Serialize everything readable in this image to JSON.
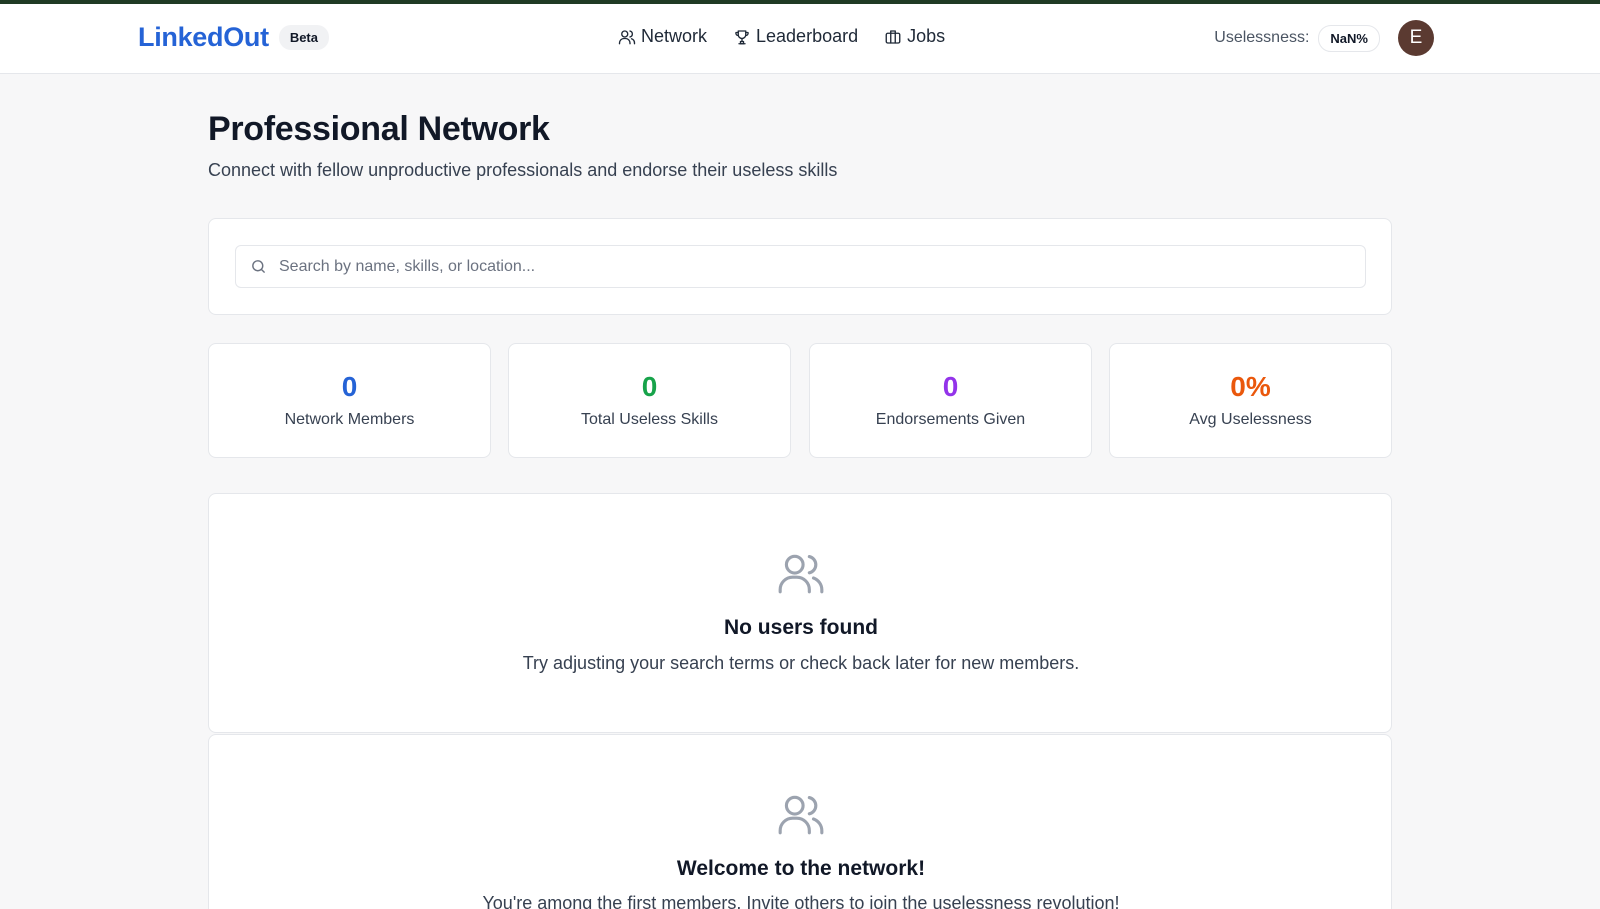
{
  "header": {
    "brand": "LinkedOut",
    "badge": "Beta",
    "nav": [
      {
        "label": "Network",
        "icon": "users-icon"
      },
      {
        "label": "Leaderboard",
        "icon": "trophy-icon"
      },
      {
        "label": "Jobs",
        "icon": "briefcase-icon"
      }
    ],
    "uselessness_label": "Uselessness:",
    "uselessness_value": "NaN%",
    "avatar_initial": "E"
  },
  "page": {
    "title": "Professional Network",
    "subtitle": "Connect with fellow unproductive professionals and endorse their useless skills"
  },
  "search": {
    "placeholder": "Search by name, skills, or location...",
    "value": ""
  },
  "stats": [
    {
      "value": "0",
      "label": "Network Members",
      "color": "#2563d6"
    },
    {
      "value": "0",
      "label": "Total Useless Skills",
      "color": "#17a34a"
    },
    {
      "value": "0",
      "label": "Endorsements Given",
      "color": "#9333ea"
    },
    {
      "value": "0%",
      "label": "Avg Uselessness",
      "color": "#ea580c"
    }
  ],
  "empty_state": {
    "title": "No users found",
    "text": "Try adjusting your search terms or check back later for new members."
  },
  "welcome": {
    "title": "Welcome to the network!",
    "text": "You're among the first members. Invite others to join the uselessness revolution!"
  },
  "colors": {
    "accent_bar": "#1f3a24",
    "brand": "#2563d6",
    "avatar_bg": "#5b3a31"
  }
}
